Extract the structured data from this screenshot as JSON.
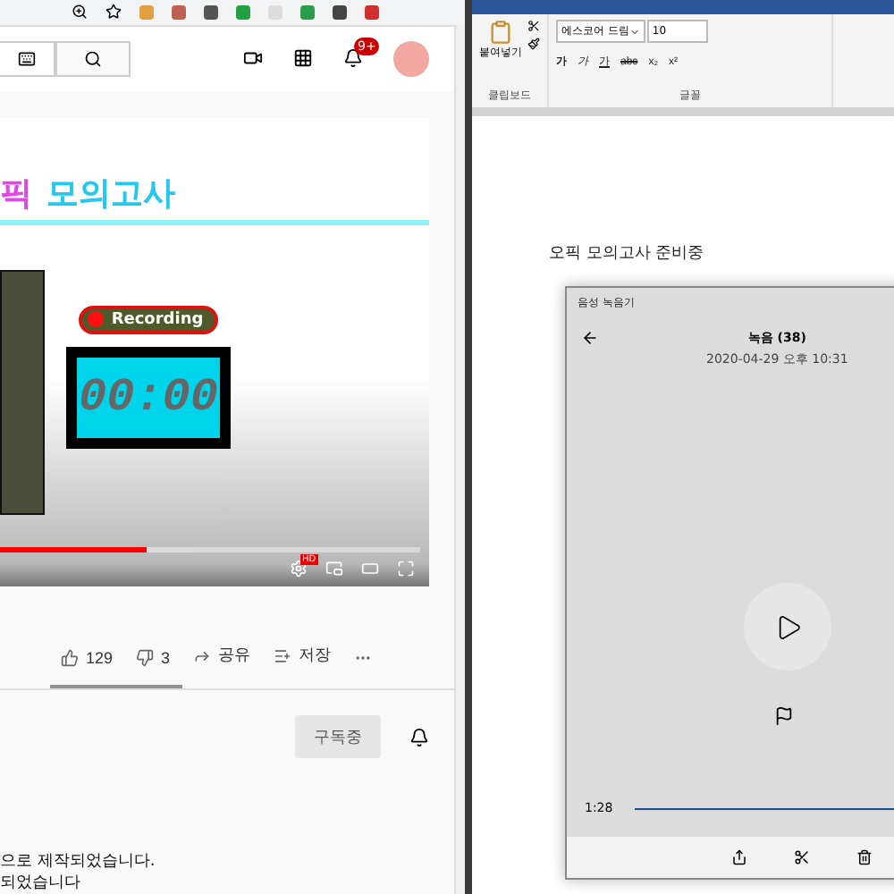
{
  "youtube": {
    "notification_badge": "9+",
    "video": {
      "title_parts": [
        {
          "text": "픽",
          "color": "#e048e6"
        },
        {
          "text": "모의고사",
          "color": "#22c8f0"
        }
      ],
      "recording_label": "Recording",
      "timer": "00:00",
      "progress": {
        "level": 0.35
      },
      "hd_badge": "HD"
    },
    "actions": [
      {
        "kind": "like",
        "label": "129"
      },
      {
        "kind": "dislike",
        "label": "3"
      },
      {
        "kind": "share",
        "label": "공유"
      },
      {
        "kind": "save",
        "label": "저장"
      },
      {
        "kind": "more"
      }
    ],
    "subscribe_button": "구독중",
    "description": [
      "으로 제작되었습니다.",
      "되었습니다"
    ]
  },
  "word": {
    "ribbon": {
      "paste": "붙여넣기",
      "clipboard_group": "클립보드",
      "font_name": "에스코어 드림",
      "font_size": "10",
      "font_group": "글꼴",
      "format_buttons": [
        {
          "kind": "bold",
          "label": "가"
        },
        {
          "kind": "italic",
          "label": "가"
        },
        {
          "kind": "underline",
          "label": "가"
        },
        {
          "kind": "strike",
          "label": "abc"
        },
        {
          "kind": "sub",
          "label": "x₂"
        },
        {
          "kind": "sup",
          "label": "x²"
        }
      ]
    },
    "document_text": "오픽 모의고사 준비중"
  },
  "recorder": {
    "title": "음성 녹음기",
    "recording_name": "녹음 (38)",
    "date": "2020-04-29 오후 10:31",
    "elapsed": "1:28"
  }
}
